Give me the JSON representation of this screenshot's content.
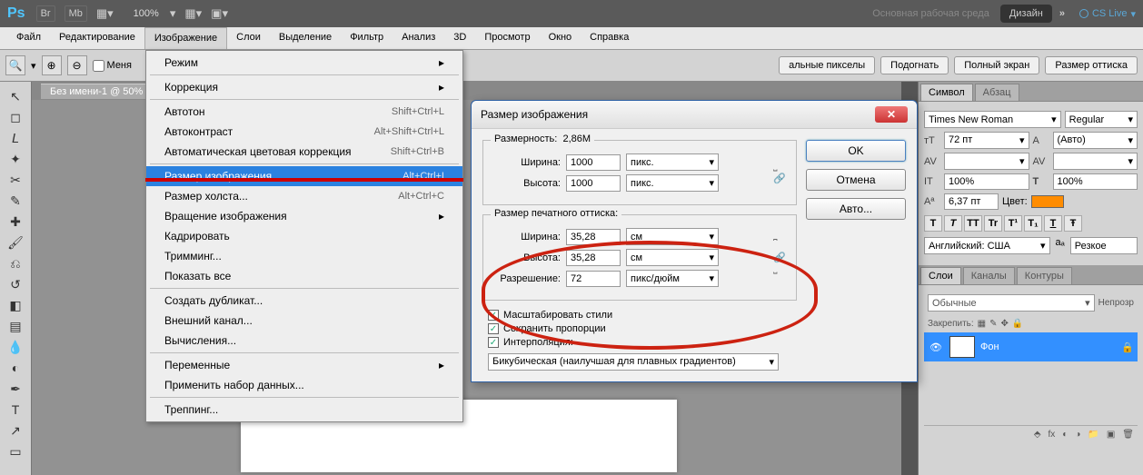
{
  "topbar": {
    "logo": "Ps",
    "items": [
      "Br",
      "Mb"
    ],
    "zoom": "100%",
    "workspace_label": "Основная рабочая среда",
    "workspace_btn": "Дизайн",
    "cslive": "CS Live"
  },
  "menu": {
    "items": [
      "Файл",
      "Редактирование",
      "Изображение",
      "Слои",
      "Выделение",
      "Фильтр",
      "Анализ",
      "3D",
      "Просмотр",
      "Окно",
      "Справка"
    ],
    "open_index": 2
  },
  "dropdown": {
    "items": [
      {
        "label": "Режим",
        "submenu": true
      },
      {
        "sep": true
      },
      {
        "label": "Коррекция",
        "submenu": true
      },
      {
        "sep": true
      },
      {
        "label": "Автотон",
        "shortcut": "Shift+Ctrl+L"
      },
      {
        "label": "Автоконтраст",
        "shortcut": "Alt+Shift+Ctrl+L"
      },
      {
        "label": "Автоматическая цветовая коррекция",
        "shortcut": "Shift+Ctrl+B"
      },
      {
        "sep": true
      },
      {
        "label": "Размер изображения...",
        "shortcut": "Alt+Ctrl+I",
        "highlighted": true
      },
      {
        "label": "Размер холста...",
        "shortcut": "Alt+Ctrl+C"
      },
      {
        "label": "Вращение изображения",
        "submenu": true
      },
      {
        "label": "Кадрировать"
      },
      {
        "label": "Тримминг..."
      },
      {
        "label": "Показать все"
      },
      {
        "sep": true
      },
      {
        "label": "Создать дубликат..."
      },
      {
        "label": "Внешний канал..."
      },
      {
        "label": "Вычисления..."
      },
      {
        "sep": true
      },
      {
        "label": "Переменные",
        "submenu": true
      },
      {
        "label": "Применить набор данных..."
      },
      {
        "sep": true
      },
      {
        "label": "Треппинг..."
      }
    ]
  },
  "optionsbar": {
    "checkbox_label": "Меня",
    "btns": [
      "альные пикселы",
      "Подогнать",
      "Полный экран",
      "Размер оттиска"
    ]
  },
  "doctab": "Без имени-1 @ 50%",
  "dialog": {
    "title": "Размер изображения",
    "buttons": {
      "ok": "OK",
      "cancel": "Отмена",
      "auto": "Авто..."
    },
    "pixel_dims": {
      "legend": "Размерность:",
      "size": "2,86M",
      "width_label": "Ширина:",
      "width_value": "1000",
      "width_unit": "пикс.",
      "height_label": "Высота:",
      "height_value": "1000",
      "height_unit": "пикс."
    },
    "print_dims": {
      "legend": "Размер печатного оттиска:",
      "width_label": "Ширина:",
      "width_value": "35,28",
      "width_unit": "см",
      "height_label": "Высота:",
      "height_value": "35,28",
      "height_unit": "см",
      "res_label": "Разрешение:",
      "res_value": "72",
      "res_unit": "пикс/дюйм"
    },
    "checks": {
      "scale_styles": "Масштабировать стили",
      "constrain": "Сохранить пропорции",
      "resample": "Интерполяция:"
    },
    "interp": "Бикубическая (наилучшая для плавных градиентов)"
  },
  "char_panel": {
    "tabs": [
      "Символ",
      "Абзац"
    ],
    "font": "Times New Roman",
    "style": "Regular",
    "size_icon": "тТ",
    "size": "72 пт",
    "leading_icon": "A",
    "leading": "(Авто)",
    "vscale": "100%",
    "hscale": "100%",
    "baseline": "6,37 пт",
    "color_label": "Цвет:",
    "type_btns": [
      "T",
      "T",
      "TT",
      "Tr",
      "T¹",
      "T₁",
      "T",
      "Ŧ"
    ],
    "lang": "Английский: США",
    "aa_label": "aₐ",
    "aa": "Резкое"
  },
  "layers_panel": {
    "tabs": [
      "Слои",
      "Каналы",
      "Контуры"
    ],
    "mode": "Обычные",
    "opacity_label": "Непрозр",
    "lock_label": "Закрепить:",
    "layer_name": "Фон"
  }
}
